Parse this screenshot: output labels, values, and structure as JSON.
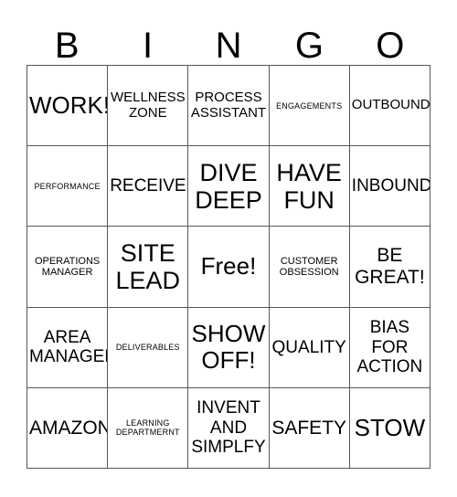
{
  "header": {
    "letters": [
      "B",
      "I",
      "N",
      "G",
      "O"
    ]
  },
  "colors": {
    "grid_line": "#575757",
    "background": "#ffffff",
    "text": "#000000"
  },
  "grid": {
    "columns": 5,
    "rows": 5,
    "cells": [
      {
        "text": "WORK!",
        "size": "fs-xxl"
      },
      {
        "text": "WELLNESS\nZONE",
        "size": "fs-m"
      },
      {
        "text": "PROCESS\nASSISTANT",
        "size": "fs-m"
      },
      {
        "text": "ENGAGEMENTS",
        "size": "fs-xs"
      },
      {
        "text": "OUTBOUND",
        "size": "fs-m"
      },
      {
        "text": "PERFORMANCE",
        "size": "fs-xs"
      },
      {
        "text": "RECEIVE",
        "size": "fs-l"
      },
      {
        "text": "DIVE\nDEEP",
        "size": "fs-xxxl"
      },
      {
        "text": "HAVE\nFUN",
        "size": "fs-xxxl"
      },
      {
        "text": "INBOUND",
        "size": "fs-l"
      },
      {
        "text": "OPERATIONS\nMANAGER",
        "size": "fs-s"
      },
      {
        "text": "SITE\nLEAD",
        "size": "fs-xxxl"
      },
      {
        "text": "Free!",
        "size": "fs-xxl"
      },
      {
        "text": "CUSTOMER\nOBSESSION",
        "size": "fs-s"
      },
      {
        "text": "BE\nGREAT!",
        "size": "fs-xl"
      },
      {
        "text": "AREA\nMANAGER",
        "size": "fs-l"
      },
      {
        "text": "DELIVERABLES",
        "size": "fs-xs"
      },
      {
        "text": "SHOW\nOFF!",
        "size": "fs-xxl"
      },
      {
        "text": "QUALITY",
        "size": "fs-l"
      },
      {
        "text": "BIAS\nFOR\nACTION",
        "size": "fs-l"
      },
      {
        "text": "AMAZON",
        "size": "fs-xl"
      },
      {
        "text": "LEARNING\nDEPARTMERNT",
        "size": "fs-xs"
      },
      {
        "text": "INVENT\nAND\nSIMPLFY",
        "size": "fs-l"
      },
      {
        "text": "SAFETY",
        "size": "fs-xl"
      },
      {
        "text": "STOW",
        "size": "fs-xxl"
      }
    ]
  }
}
